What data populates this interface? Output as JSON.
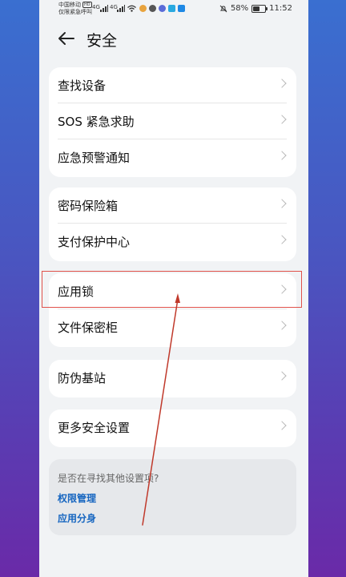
{
  "status_bar": {
    "carrier_line1": "中国移动",
    "carrier_badge": "HD",
    "carrier_line2": "仅限紧急呼叫",
    "signal1": "4G",
    "signal2": "4G",
    "battery_percent": "58%",
    "battery_level": 0.58,
    "time": "11:52"
  },
  "header": {
    "title": "安全"
  },
  "groups": [
    {
      "items": [
        {
          "label": "查找设备"
        },
        {
          "label": "SOS 紧急求助"
        },
        {
          "label": "应急预警通知"
        }
      ]
    },
    {
      "items": [
        {
          "label": "密码保险箱"
        },
        {
          "label": "支付保护中心"
        }
      ]
    },
    {
      "items": [
        {
          "label": "应用锁"
        },
        {
          "label": "文件保密柜"
        }
      ]
    },
    {
      "items": [
        {
          "label": "防伪基站"
        }
      ]
    },
    {
      "items": [
        {
          "label": "更多安全设置"
        }
      ]
    }
  ],
  "suggestions": {
    "question": "是否在寻找其他设置项?",
    "links": [
      {
        "label": "权限管理"
      },
      {
        "label": "应用分身"
      }
    ]
  },
  "annotation": {
    "color": "#e0524b",
    "arrow_color": "#c0392b"
  }
}
